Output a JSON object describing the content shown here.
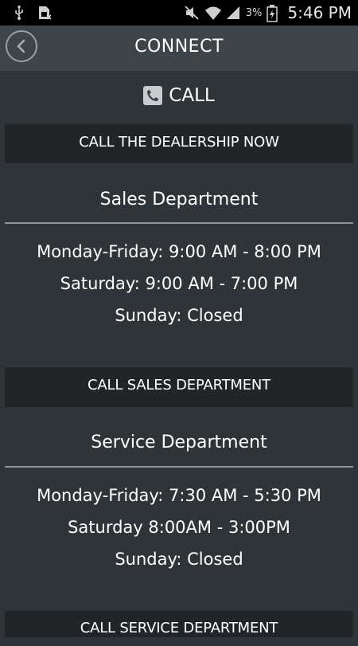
{
  "status_bar": {
    "battery": "3%",
    "time": "5:46 PM",
    "icons": [
      "usb-icon",
      "sim-icon",
      "mute-icon",
      "wifi-icon",
      "signal-icon",
      "battery-icon"
    ]
  },
  "header": {
    "title": "CONNECT",
    "back_icon": "chevron-left-icon"
  },
  "call_section": {
    "label": "CALL",
    "icon": "phone-icon"
  },
  "buttons": {
    "call_dealership": "CALL THE DEALERSHIP NOW",
    "call_sales": "CALL SALES DEPARTMENT",
    "call_service": "CALL SERVICE DEPARTMENT"
  },
  "sales": {
    "title": "Sales Department",
    "hours": [
      "Monday-Friday: 9:00 AM - 8:00 PM",
      "Saturday: 9:00 AM - 7:00 PM",
      "Sunday: Closed"
    ]
  },
  "service": {
    "title": "Service Department",
    "hours": [
      "Monday-Friday: 7:30 AM - 5:30 PM",
      "Saturday 8:00AM - 3:00PM",
      "Sunday: Closed"
    ]
  },
  "colors": {
    "background": "#2f3438",
    "titlebar": "#3e4448",
    "button": "#212528",
    "divider": "#8f9497"
  }
}
